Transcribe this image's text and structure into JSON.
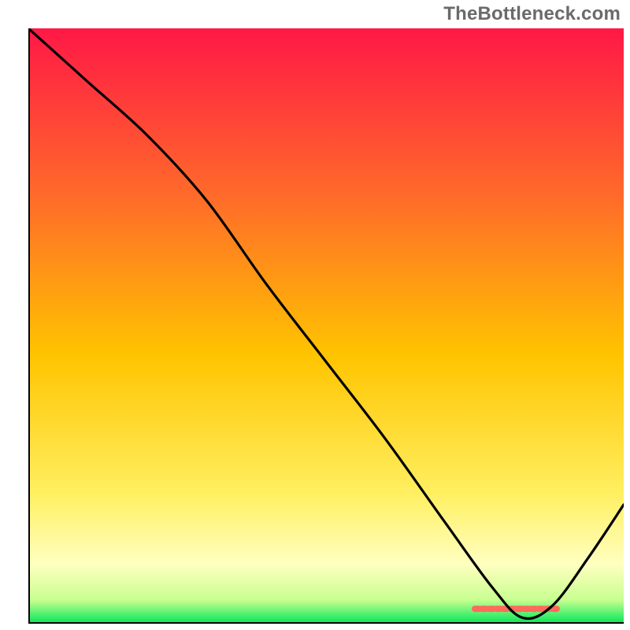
{
  "watermark": "TheBottleneck.com",
  "chart_data": {
    "type": "line",
    "title": "",
    "xlabel": "",
    "ylabel": "",
    "xlim": [
      0,
      100
    ],
    "ylim": [
      0,
      100
    ],
    "grid": false,
    "legend": false,
    "background_gradient": [
      "#ff1846",
      "#ff9f1e",
      "#ffe400",
      "#ffffb4",
      "#00e65a"
    ],
    "marker": {
      "x": 82,
      "y": 2.5,
      "color": "#ff6a5a",
      "note": "salmon dashed segment near curve minimum"
    },
    "series": [
      {
        "name": "curve",
        "color": "#000000",
        "x": [
          0,
          10,
          20,
          30,
          40,
          50,
          60,
          70,
          78,
          83,
          88,
          94,
          100
        ],
        "y": [
          100,
          91,
          82,
          71,
          57,
          44,
          31,
          17,
          6,
          1,
          3,
          11,
          20
        ]
      }
    ]
  }
}
